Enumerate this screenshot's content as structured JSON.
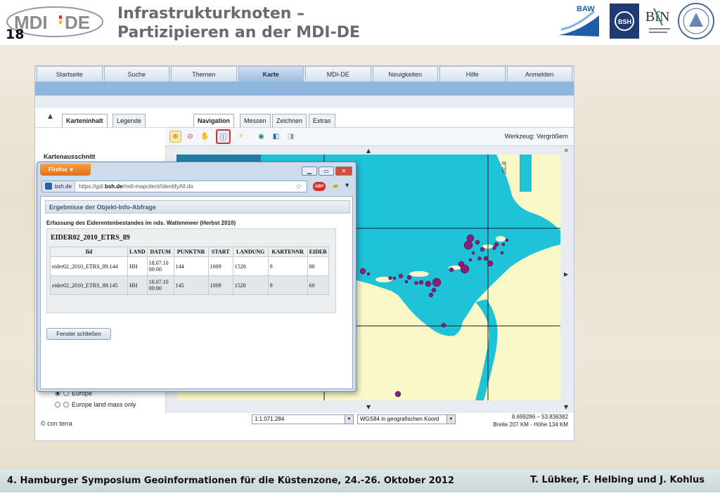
{
  "slide": {
    "number": "18",
    "title_line1": "Infrastrukturknoten –",
    "title_line2": "Partizipieren an der MDI-DE",
    "logo_text": "MDI-DE",
    "partners": [
      "BAW",
      "BSH",
      "BfN"
    ]
  },
  "app": {
    "nav_tabs": [
      "Startseite",
      "Suche",
      "Themen",
      "Karte",
      "MDI-DE",
      "Neuigkeiten",
      "Hilfe",
      "Anmelden"
    ],
    "active_nav": "Karte",
    "left_tabs": [
      "Karteninhalt",
      "Legende"
    ],
    "right_tabs": [
      "Navigation",
      "Messen",
      "Zeichnen",
      "Extras"
    ],
    "tool_label": "Werkzeug: Vergrößern",
    "sidebar_title": "Kartenausschnitt",
    "radio_europe": "Europe",
    "radio_europe_land": "Europe land mass only",
    "copyright": "© con terra",
    "scale_value": "1:1.071.284",
    "crs_value": "WGS84 in geografischen Koord",
    "coord_readout": "8.699286 – 53.836382",
    "extent_readout": "Breite 207 KM - Höhe 134 KM",
    "map_grid_label": "8°30'",
    "icons": [
      "zoom-in-icon",
      "zoom-out-icon",
      "pan-hand-icon",
      "info-icon",
      "lightning-icon",
      "globe-icon",
      "back-icon",
      "forward-icon"
    ]
  },
  "popup": {
    "browser_button": "Firefox",
    "url_site": "bsh.de",
    "url_prefix": "https://gdi.",
    "url_domain": "bsh.de",
    "url_rest": "/mdi-mapclient/IdentifyAll.do",
    "result_header": "Ergebnisse der Objekt-Info-Abfrage",
    "subtitle": "Erfassung des Eiderentenbestandes im nds. Wattenmeer (Herbst 2010)",
    "table_title": "EIDER02_2010_ETRS_89",
    "columns": [
      "fid",
      "LAND",
      "DATUM",
      "PUNKTNR",
      "START",
      "LANDUNG",
      "KARTENNR",
      "EIDER"
    ],
    "rows": [
      [
        "eider02_2010_ETRS_89.144",
        "HH",
        "18.07.10 00:00",
        "144",
        "1009",
        "1520",
        "9",
        "80"
      ],
      [
        "eider02_2010_ETRS_89.145",
        "HH",
        "18.07.10 00:00",
        "145",
        "1009",
        "1520",
        "9",
        "60"
      ]
    ],
    "close_button": "Fenster schließen"
  },
  "footer": {
    "left": "4. Hamburger Symposium Geoinformationen für die Küstenzone, 24.-26. Oktober 2012",
    "right": "T. Lübker, F. Helbing und J. Kohlus"
  },
  "colors": {
    "water": "#1fc3d8",
    "land": "#fbf8c8",
    "points": "#8a1f7a",
    "nav_active": "#9fbddf",
    "firefox": "#e8781c"
  }
}
